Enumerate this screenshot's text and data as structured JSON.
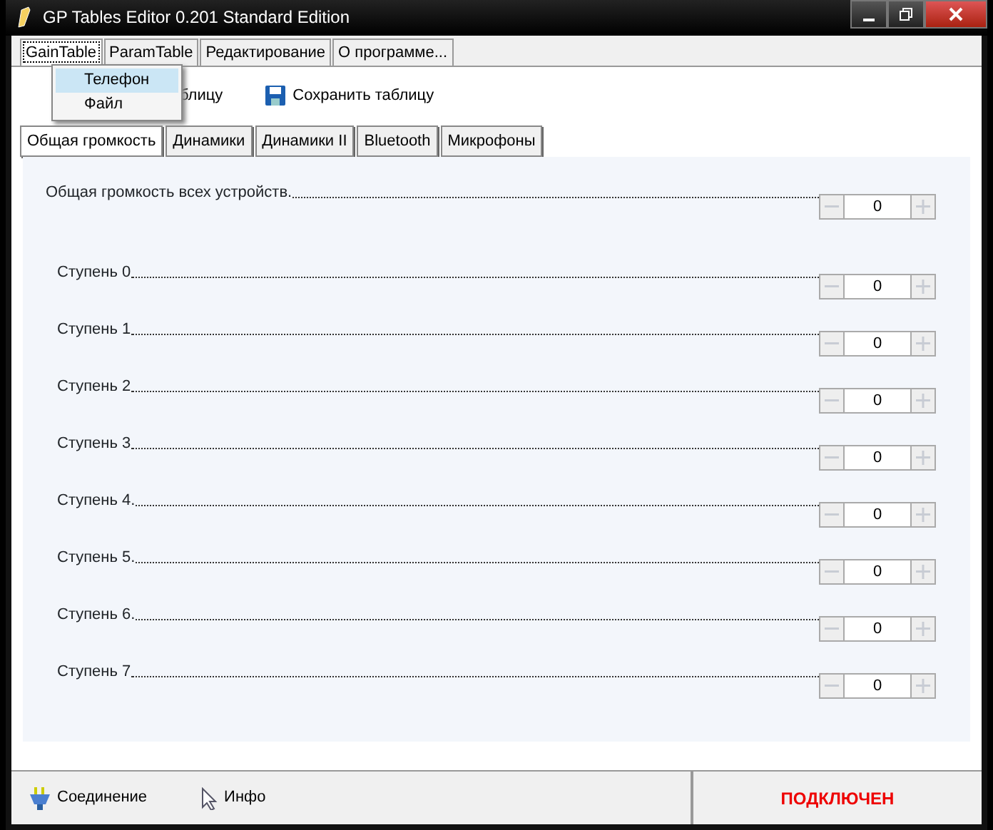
{
  "window": {
    "title": "GP Tables Editor 0.201 Standard Edition"
  },
  "tabs": [
    {
      "label": "GainTable",
      "selected": true
    },
    {
      "label": "ParamTable",
      "selected": false
    },
    {
      "label": "Редактирование",
      "selected": false
    },
    {
      "label": "О программе...",
      "selected": false
    }
  ],
  "menu": {
    "items": [
      {
        "label": "Телефон",
        "selected": true
      },
      {
        "label": "Файл",
        "selected": false
      }
    ]
  },
  "toolbar": [
    {
      "label": "блицу",
      "kind": "partial"
    },
    {
      "label": "Сохранить таблицу",
      "kind": "save"
    }
  ],
  "subtabs": [
    {
      "label": "Общая громкость",
      "selected": true
    },
    {
      "label": "Динамики",
      "selected": false
    },
    {
      "label": "Динамики II",
      "selected": false
    },
    {
      "label": "Bluetooth",
      "selected": false
    },
    {
      "label": "Микрофоны",
      "selected": false
    }
  ],
  "rows": [
    {
      "label": "Общая громкость всех устройств.",
      "value": "0",
      "kind": "master"
    },
    {
      "label": "Ступень 0",
      "value": "0",
      "kind": "step"
    },
    {
      "label": "Ступень 1",
      "value": "0",
      "kind": "step"
    },
    {
      "label": "Ступень 2",
      "value": "0",
      "kind": "step"
    },
    {
      "label": "Ступень 3",
      "value": "0",
      "kind": "step"
    },
    {
      "label": "Ступень 4.",
      "value": "0",
      "kind": "step"
    },
    {
      "label": "Ступень 5.",
      "value": "0",
      "kind": "step"
    },
    {
      "label": "Ступень 6.",
      "value": "0",
      "kind": "step"
    },
    {
      "label": "Ступень 7",
      "value": "0",
      "kind": "step"
    }
  ],
  "status_bar": {
    "items": [
      {
        "label": "Соединение",
        "kind": "connection"
      },
      {
        "label": "Инфо",
        "kind": "info"
      }
    ],
    "state": "ПОДКЛЮЧЕН"
  }
}
